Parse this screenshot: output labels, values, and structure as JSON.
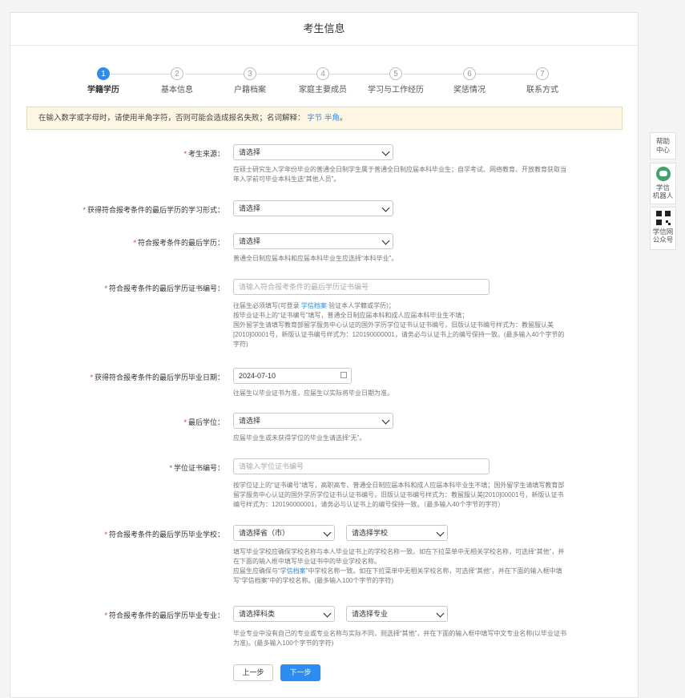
{
  "header": {
    "title": "考生信息"
  },
  "steps": [
    {
      "num": "1",
      "label": "学籍学历"
    },
    {
      "num": "2",
      "label": "基本信息"
    },
    {
      "num": "3",
      "label": "户籍档案"
    },
    {
      "num": "4",
      "label": "家庭主要成员"
    },
    {
      "num": "5",
      "label": "学习与工作经历"
    },
    {
      "num": "6",
      "label": "奖惩情况"
    },
    {
      "num": "7",
      "label": "联系方式"
    }
  ],
  "notice": {
    "text": "在输入数字或字母时，请使用半角字符，否则可能会造成报名失败；名词解释：",
    "link1": "字节",
    "link2": "半角",
    "tail": "。"
  },
  "fields": {
    "source": {
      "label": "考生来源：",
      "value": "请选择",
      "hint1": "在硕士研究生入学年份毕业的普通全日制学生属于普通全日制应届本科毕业生；自学考试、网络教育、开放教育获取当",
      "hint2": "年入学前可毕业本科生选“其他人员”。"
    },
    "study_form": {
      "label": "获得符合报考条件的最后学历的学习形式：",
      "value": "请选择"
    },
    "last_degree": {
      "label": "符合报考条件的最后学历：",
      "value": "请选择",
      "hint1": "普通全日制应届本科和应届本科毕业生应选择“本科毕业”。"
    },
    "cert_no": {
      "label": "符合报考条件的最后学历证书编号：",
      "placeholder": "请输入符合报考条件的最后学历证书编号",
      "hint1_pre": "往届生必须填写(可登录",
      "hint1_link": "学信档案",
      "hint1_post": "验证本人学籍或学历)；",
      "hint2": "按毕业证书上的“证书编号”填写，普通全日制应届本科和成人应届本科毕业生不填；",
      "hint3": "国外留学生请填写教育部留学服务中心认证的国外学历学位证书认证书编号，旧版认证书编号样式为：教留服认美",
      "hint4": "[2010]00001号，新版认证书编号样式为：120190000001，请务必与认证书上的编号保持一致。(最多输入40个字节的",
      "hint5": "字符)"
    },
    "grad_date": {
      "label": "获得符合报考条件的最后学历毕业日期：",
      "value": "2024-07-10",
      "hint1": "往届生以毕业证书为准，应届生以实际将毕业日期为准。"
    },
    "degree": {
      "label": "最后学位：",
      "value": "请选择",
      "hint1": "应届毕业生或未获得学位的毕业生请选择“无”。"
    },
    "degree_cert": {
      "label": "学位证书编号：",
      "placeholder": "请输入学位证书编号",
      "hint1": "按学位证上的“证书编号”填写，高职高专、普通全日制应届本科和成人应届本科毕业生不填；国外留学生请填写教育部",
      "hint2": "留学服务中心认证的国外学历学位证书认证书编号，旧版认证书编号样式为：教留服认美[2010]00001号，新版认证书",
      "hint3": "编号样式为：120190000001，请务必与认证书上的编号保持一致。（最多输入40个字节的字符）"
    },
    "school": {
      "label": "符合报考条件的最后学历毕业学校：",
      "province": "请选择省（市）",
      "school": "请选择学校",
      "hint1": "填写毕业学校应确保学校名称与本人毕业证书上的学校名称一致。如在下拉菜单中无相关学校名称，可选择“其他”，并",
      "hint2": "在下面的输入框中填写毕业证书中的毕业学校名称。",
      "hint3_pre": "应届生应确保与“",
      "hint3_link": "学信档案",
      "hint3_post": "”中学校名称一致。如在下拉菜单中无相关学校名称，可选择“其他”，并在下面的输入框中填",
      "hint4": "写“学信档案”中的学校名称。(最多输入100个字节的字符)"
    },
    "major": {
      "label": "符合报考条件的最后学历毕业专业：",
      "category": "请选择科类",
      "major": "请选择专业",
      "hint1": "毕业专业中没有自己的专业或专业名称与实际不同，则选择“其他”，并在下面的输入框中填写中文专业名称(以毕业证书",
      "hint2": "为准)。(最多输入100个字节的字符)"
    }
  },
  "buttons": {
    "prev": "上一步",
    "next": "下一步"
  },
  "side": {
    "help": [
      "帮助",
      "中心"
    ],
    "robot": [
      "学信",
      "机器人"
    ],
    "qr": [
      "学信网",
      "公众号"
    ]
  }
}
